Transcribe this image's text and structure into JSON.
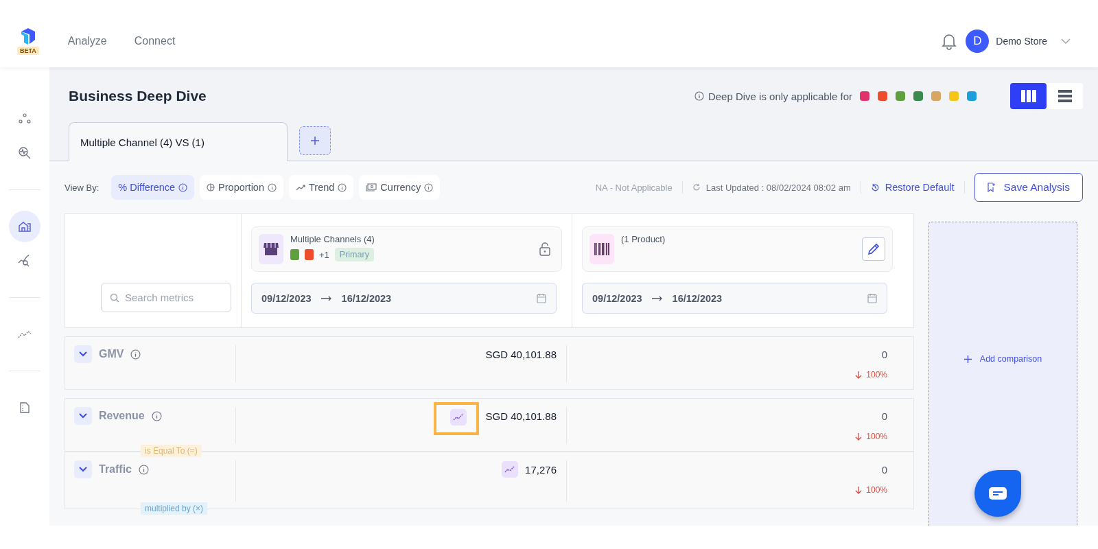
{
  "header": {
    "badge": "BETA",
    "nav": [
      "Analyze",
      "Connect"
    ],
    "user": {
      "initial": "D",
      "name": "Demo Store"
    }
  },
  "sidebar": {
    "items": [
      {
        "kind": "nodes",
        "selected": false,
        "divider_before": false
      },
      {
        "kind": "pulse-search",
        "selected": false,
        "divider_before": false
      },
      {
        "kind": "store",
        "selected": true,
        "divider_before": true
      },
      {
        "kind": "chart-search",
        "selected": false,
        "divider_before": false
      },
      {
        "kind": "trend",
        "selected": false,
        "divider_before": true
      },
      {
        "kind": "document",
        "selected": false,
        "divider_before": true
      }
    ]
  },
  "page": {
    "title": "Business Deep Dive",
    "notice": "Deep Dive is only applicable for",
    "platforms": [
      {
        "color": "#e0326b"
      },
      {
        "color": "#ee4d2d"
      },
      {
        "color": "#5ea03e"
      },
      {
        "color": "#3b8a4e"
      },
      {
        "color": "#d9a560"
      },
      {
        "color": "#f5c518"
      },
      {
        "color": "#1ba0dc"
      }
    ],
    "view_toggle": [
      {
        "kind": "columns",
        "selected": true
      },
      {
        "kind": "rows",
        "selected": false
      }
    ]
  },
  "tabs": [
    {
      "label": "Multiple Channel (4) VS (1)",
      "selected": true
    }
  ],
  "view_by": {
    "label": "View By:",
    "options": [
      {
        "kind": "percent",
        "label": "% Difference",
        "selected": true
      },
      {
        "kind": "proportion",
        "label": "Proportion",
        "selected": false
      },
      {
        "kind": "trend",
        "label": "Trend",
        "selected": false
      },
      {
        "kind": "currency",
        "label": "Currency",
        "selected": false
      }
    ]
  },
  "status": {
    "na": "NA - Not Applicable",
    "last_updated": "Last Updated : 08/02/2024 08:02 am",
    "restore": "Restore Default",
    "save": "Save Analysis"
  },
  "search": {
    "placeholder": "Search metrics"
  },
  "comparisons": [
    {
      "kind": "channels",
      "title": "Multiple Channels (4)",
      "channels": [
        {
          "color": "#5ea03e"
        },
        {
          "color": "#ee4d2d"
        }
      ],
      "extra": "+1",
      "tag": "Primary",
      "locked": true,
      "start": "09/12/2023",
      "end": "16/12/2023"
    },
    {
      "kind": "product",
      "title": "(1 Product)",
      "locked": false,
      "start": "09/12/2023",
      "end": "16/12/2023"
    }
  ],
  "metrics": [
    {
      "name": "GMV",
      "values": [
        {
          "value": "SGD 40,101.88",
          "trend_button": false
        },
        {
          "value": "0",
          "change": "100%",
          "decrease": true
        }
      ]
    },
    {
      "name": "Revenue",
      "values": [
        {
          "value": "SGD 40,101.88",
          "trend_button": true,
          "highlighted": true
        },
        {
          "value": "0",
          "change": "100%",
          "decrease": true
        }
      ],
      "relation": {
        "kind": "equal",
        "label": "is Equal To (=)"
      }
    },
    {
      "name": "Traffic",
      "values": [
        {
          "value": "17,276",
          "trend_button": true,
          "highlighted": false
        },
        {
          "value": "0",
          "change": "100%",
          "decrease": true
        }
      ],
      "relation": {
        "kind": "multiply",
        "label": "multiplied by (×)"
      }
    }
  ],
  "add_comparison": "Add comparison"
}
